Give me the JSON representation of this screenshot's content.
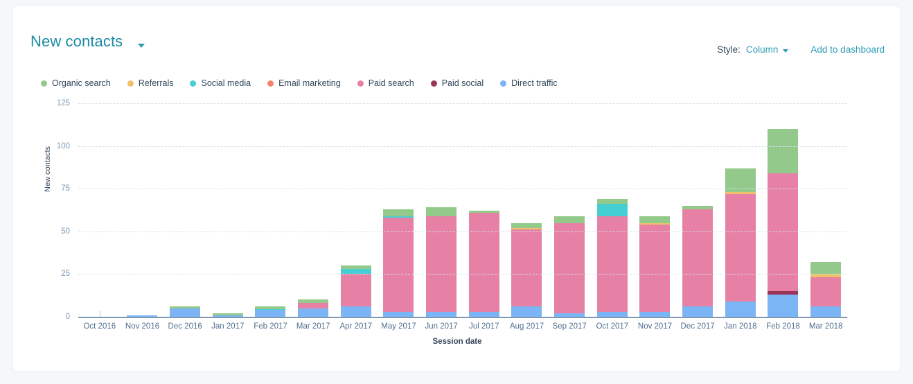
{
  "header": {
    "title": "New contacts",
    "title_caret_icon": "chevron-down-icon",
    "style_label": "Style:",
    "style_value": "Column",
    "style_caret_icon": "chevron-down-icon",
    "add_to_dashboard": "Add to dashboard"
  },
  "colors": {
    "accent": "#2e9cb7",
    "title": "#1b8aa3",
    "text": "#33475b",
    "axis_text": "#516f90",
    "grid": "#d6dfe8",
    "card_bg": "#ffffff",
    "page_bg": "#f5f8fa"
  },
  "chart_data": {
    "type": "bar",
    "stacked": true,
    "title": "New contacts",
    "xlabel": "Session date",
    "ylabel": "New contacts",
    "ylim": [
      0,
      125
    ],
    "yticks": [
      0,
      25,
      50,
      75,
      100,
      125
    ],
    "grid": true,
    "legend_position": "top-left",
    "categories": [
      "Oct 2016",
      "Nov 2016",
      "Dec 2016",
      "Jan 2017",
      "Feb 2017",
      "Mar 2017",
      "Apr 2017",
      "May 2017",
      "Jun 2017",
      "Jul 2017",
      "Aug 2017",
      "Sep 2017",
      "Oct 2017",
      "Nov 2017",
      "Dec 2017",
      "Jan 2018",
      "Feb 2018",
      "Mar 2018"
    ],
    "series": [
      {
        "name": "Direct traffic",
        "color": "#7cb5f5",
        "values": [
          0,
          1,
          5,
          1,
          4,
          5,
          6,
          3,
          3,
          3,
          6,
          2,
          3,
          3,
          6,
          9,
          13,
          6
        ]
      },
      {
        "name": "Paid social",
        "color": "#9b3459",
        "values": [
          0,
          0,
          0,
          0,
          0,
          0,
          0,
          0,
          0,
          0,
          0,
          0,
          0,
          0,
          0,
          0,
          2,
          0
        ]
      },
      {
        "name": "Paid search",
        "color": "#e681a5",
        "values": [
          0,
          0,
          0,
          0,
          0,
          3,
          19,
          55,
          56,
          58,
          45,
          53,
          56,
          51,
          57,
          63,
          69,
          17
        ]
      },
      {
        "name": "Email marketing",
        "color": "#f5836b",
        "values": [
          0,
          0,
          0,
          0,
          0,
          0,
          0,
          0,
          0,
          0,
          0,
          0,
          0,
          0,
          0,
          0,
          0,
          0
        ]
      },
      {
        "name": "Social media",
        "color": "#45cfd2",
        "values": [
          0,
          0,
          0,
          0,
          0.5,
          0,
          3,
          1,
          0,
          0,
          0,
          0,
          7,
          0,
          0,
          0,
          0,
          0
        ]
      },
      {
        "name": "Referrals",
        "color": "#eec16a",
        "values": [
          0,
          0,
          0,
          0,
          0,
          0,
          0,
          0,
          0,
          0,
          1,
          0,
          0,
          1,
          0,
          1,
          0,
          2
        ]
      },
      {
        "name": "Organic search",
        "color": "#93c98a",
        "values": [
          0,
          0,
          1,
          1,
          1.5,
          2,
          2,
          4,
          5,
          1,
          3,
          4,
          3,
          4,
          2,
          14,
          26,
          7
        ]
      }
    ],
    "totals": [
      0.5,
      1,
      6,
      2,
      6,
      10,
      30,
      63,
      64,
      62,
      55,
      59,
      69,
      59,
      65,
      87,
      110,
      32
    ]
  },
  "legend": {
    "items": [
      {
        "label": "Organic search",
        "color": "#93c98a"
      },
      {
        "label": "Referrals",
        "color": "#eec16a"
      },
      {
        "label": "Social media",
        "color": "#45cfd2"
      },
      {
        "label": "Email marketing",
        "color": "#f5836b"
      },
      {
        "label": "Paid search",
        "color": "#e681a5"
      },
      {
        "label": "Paid social",
        "color": "#9b3459"
      },
      {
        "label": "Direct traffic",
        "color": "#7cb5f5"
      }
    ]
  }
}
